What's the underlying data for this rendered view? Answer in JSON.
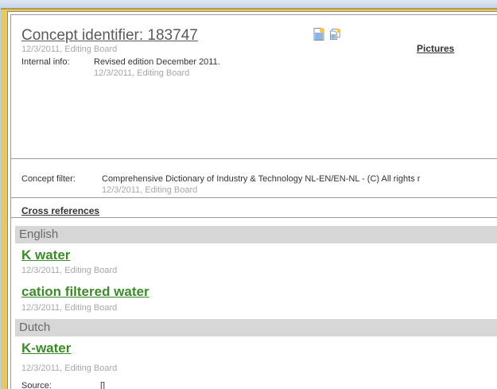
{
  "concept": {
    "title": "Concept identifier: 183747",
    "meta": "12/3/2011, Editing Board",
    "pictures_label": "Pictures",
    "icons": [
      "new-page-icon",
      "copy-page-icon"
    ]
  },
  "internal_info": {
    "label": "Internal info:",
    "value": "Revised edition December 2011.",
    "meta": "12/3/2011, Editing Board"
  },
  "concept_filter": {
    "label": "Concept filter:",
    "value": "Comprehensive Dictionary of Industry & Technology NL-EN/EN-NL - (C) All rights r",
    "meta": "12/3/2011, Editing Board"
  },
  "cross_references_label": "Cross references",
  "languages": [
    {
      "name": "English",
      "terms": [
        {
          "term": "K water",
          "meta": "12/3/2011, Editing Board"
        },
        {
          "term": "cation filtered water",
          "meta": "12/3/2011, Editing Board"
        }
      ]
    },
    {
      "name": "Dutch",
      "terms": [
        {
          "term": "K-water",
          "meta": "12/3/2011, Editing Board"
        }
      ]
    }
  ],
  "source": {
    "label": "Source:",
    "value": "[]"
  },
  "colors": {
    "term_green": "#3d8a2a",
    "language_bar": "#d7d7d7",
    "outer_frame": "#e4c968"
  }
}
